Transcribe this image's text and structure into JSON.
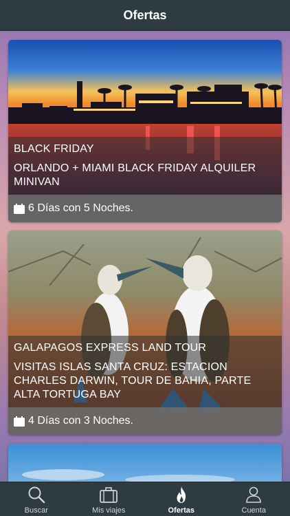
{
  "header": {
    "title": "Ofertas"
  },
  "offers": [
    {
      "tag": "BLACK FRIDAY",
      "title": "ORLANDO + MIAMI BLACK FRIDAY ALQUILER MINIVAN",
      "duration": "6 Días con 5 Noches."
    },
    {
      "tag": "GALAPAGOS EXPRESS LAND TOUR",
      "title": "VISITAS ISLAS SANTA CRUZ: ESTACION CHARLES DARWIN, TOUR DE BAHIA, PARTE ALTA TORTUGA BAY",
      "duration": "4 Días con 3 Noches."
    }
  ],
  "tabbar": {
    "items": [
      {
        "label": "Buscar",
        "icon": "search-icon"
      },
      {
        "label": "Mis viajes",
        "icon": "briefcase-icon"
      },
      {
        "label": "Ofertas",
        "icon": "flame-icon",
        "active": true
      },
      {
        "label": "Cuenta",
        "icon": "user-icon"
      }
    ]
  }
}
